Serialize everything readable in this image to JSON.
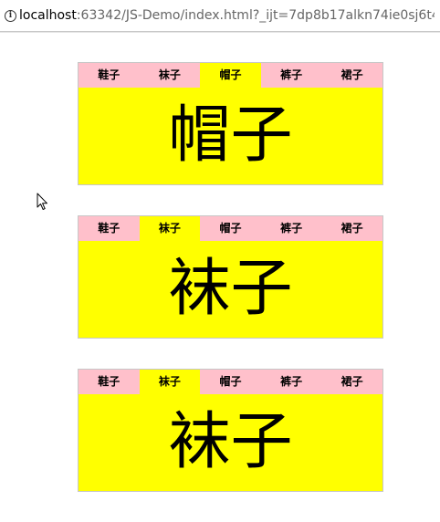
{
  "browser": {
    "url_host": "localhost",
    "url_rest": ":63342/JS-Demo/index.html?_ijt=7dp8b17alkn74ie0sj6t4..."
  },
  "tab_widgets": [
    {
      "tabs": [
        "鞋子",
        "袜子",
        "帽子",
        "裤子",
        "裙子"
      ],
      "active_index": 2,
      "content": "帽子"
    },
    {
      "tabs": [
        "鞋子",
        "袜子",
        "帽子",
        "裤子",
        "裙子"
      ],
      "active_index": 1,
      "content": "袜子"
    },
    {
      "tabs": [
        "鞋子",
        "袜子",
        "帽子",
        "裤子",
        "裙子"
      ],
      "active_index": 1,
      "content": "袜子"
    }
  ],
  "colors": {
    "tab_background": "#ffc0cb",
    "active_background": "#ffff00",
    "content_background": "#ffff00"
  }
}
